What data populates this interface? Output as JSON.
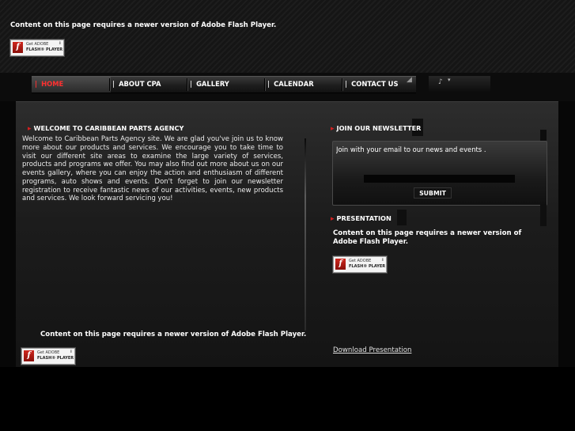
{
  "flash": {
    "message": "Content on this page requires a newer version of Adobe Flash Player.",
    "badge_line1": "Get ADOBE",
    "badge_line2": "FLASH® PLAYER",
    "badge_logo": "f"
  },
  "nav": {
    "items": [
      {
        "label": "HOME",
        "active": true
      },
      {
        "label": "ABOUT CPA",
        "active": false
      },
      {
        "label": "GALLERY",
        "active": false
      },
      {
        "label": "CALENDAR",
        "active": false
      },
      {
        "label": "CONTACT US",
        "active": false
      }
    ],
    "separator": "|"
  },
  "welcome": {
    "heading": "WELCOME TO CARIBBEAN PARTS AGENCY",
    "body": "Welcome to Caribbean Parts Agency site.  We are glad you've join us to know more about our products and services.  We encourage you to take time to visit our different site areas to examine the large variety of services, products and programs we offer.  You may also find out more about us on our events gallery, where you can enjoy the action and enthusiasm of different programs, auto shows and events. Don't forget to join our newsletter registration to receive fantastic news of our activities, events, new products and services.  We look forward servicing you!"
  },
  "newsletter": {
    "heading": "JOIN OUR NEWSLETTER",
    "input_value": "Join with your email to our news and events .",
    "submit_label": "SUBMIT"
  },
  "presentation": {
    "heading": "PRESENTATION",
    "download_label": "Download Presentation"
  },
  "icons": {
    "bullet": "▸",
    "flash_logo": "flash-player-icon",
    "tools": "music-note-icon"
  },
  "colors": {
    "accent": "#d42020",
    "active_nav": "#ff3030",
    "background": "#070707"
  }
}
